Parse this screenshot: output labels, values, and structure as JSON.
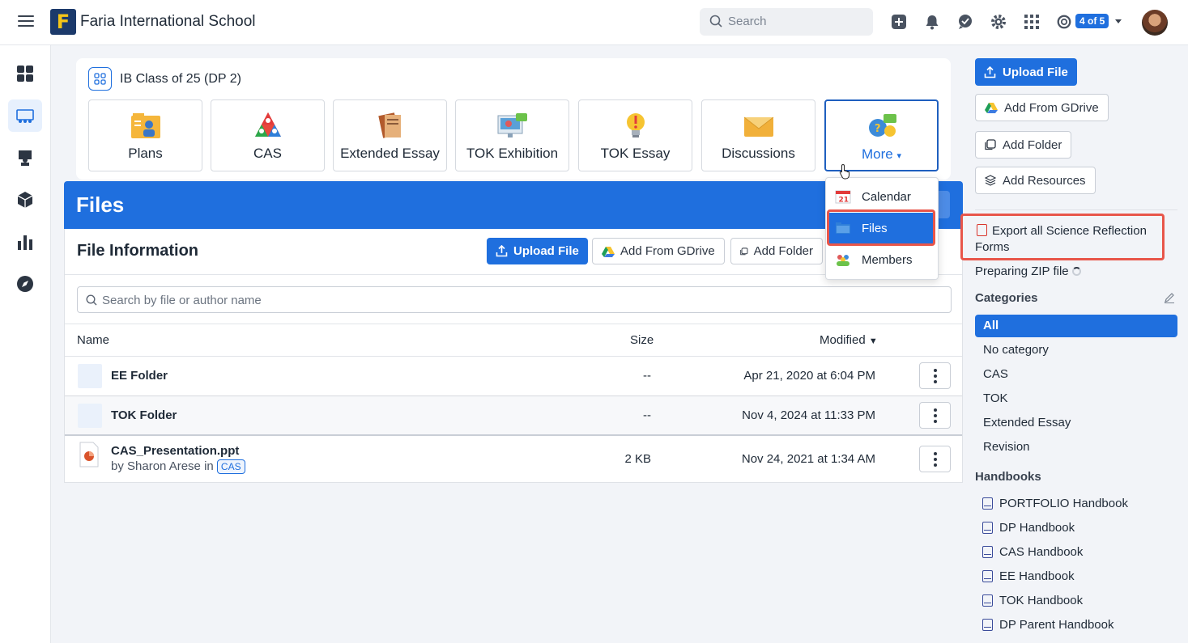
{
  "topbar": {
    "school_name": "Faria International School",
    "logo_letter": "F",
    "search_placeholder": "Search",
    "counter": "4 of 5"
  },
  "class_card": {
    "title": "IB Class of 25 (DP 2)",
    "tiles": [
      {
        "label": "Plans",
        "icon": "plans-icon"
      },
      {
        "label": "CAS",
        "icon": "cas-icon"
      },
      {
        "label": "Extended Essay",
        "icon": "extended-essay-icon"
      },
      {
        "label": "TOK Exhibition",
        "icon": "tok-exhibition-icon"
      },
      {
        "label": "TOK Essay",
        "icon": "tok-essay-icon"
      },
      {
        "label": "Discussions",
        "icon": "discussions-icon"
      },
      {
        "label": "More",
        "icon": "more-icon"
      }
    ]
  },
  "menu": {
    "items": [
      {
        "label": "Calendar",
        "icon": "calendar-icon",
        "badge": "21"
      },
      {
        "label": "Files",
        "icon": "folder-icon"
      },
      {
        "label": "Members",
        "icon": "members-icon"
      }
    ]
  },
  "files": {
    "header_title": "Files",
    "section_title": "File Information",
    "upload_label": "Upload File",
    "gdrive_label": "Add From GDrive",
    "folder_label": "Add Folder",
    "search_placeholder": "Search by file or author name",
    "columns": {
      "name": "Name",
      "size": "Size",
      "modified": "Modified"
    },
    "rows": [
      {
        "name": "EE Folder",
        "size": "--",
        "modified": "Apr 21, 2020 at 6:04 PM"
      },
      {
        "name": "TOK Folder",
        "size": "--",
        "modified": "Nov 4, 2024 at 11:33 PM"
      },
      {
        "name": "CAS_Presentation.ppt",
        "author": "by Sharon Arese in",
        "tag": "CAS",
        "size": "2 KB",
        "modified": "Nov 24, 2021 at 1:34 AM"
      }
    ]
  },
  "right_panel": {
    "upload_label": "Upload File",
    "gdrive_label": "Add From GDrive",
    "folder_label": "Add Folder",
    "resources_label": "Add Resources",
    "export_label": "Export all Science Reflection Forms",
    "preparing_label": "Preparing ZIP file",
    "categories_title": "Categories",
    "categories": [
      "All",
      "No category",
      "CAS",
      "TOK",
      "Extended Essay",
      "Revision"
    ],
    "handbooks_title": "Handbooks",
    "handbooks": [
      "PORTFOLIO Handbook",
      "DP Handbook",
      "CAS Handbook",
      "EE Handbook",
      "TOK Handbook",
      "DP Parent Handbook"
    ]
  },
  "colors": {
    "primary": "#1f6fde",
    "highlight": "#e8564a",
    "logo_bg": "#1c3a6b",
    "logo_fg": "#f5c518"
  }
}
